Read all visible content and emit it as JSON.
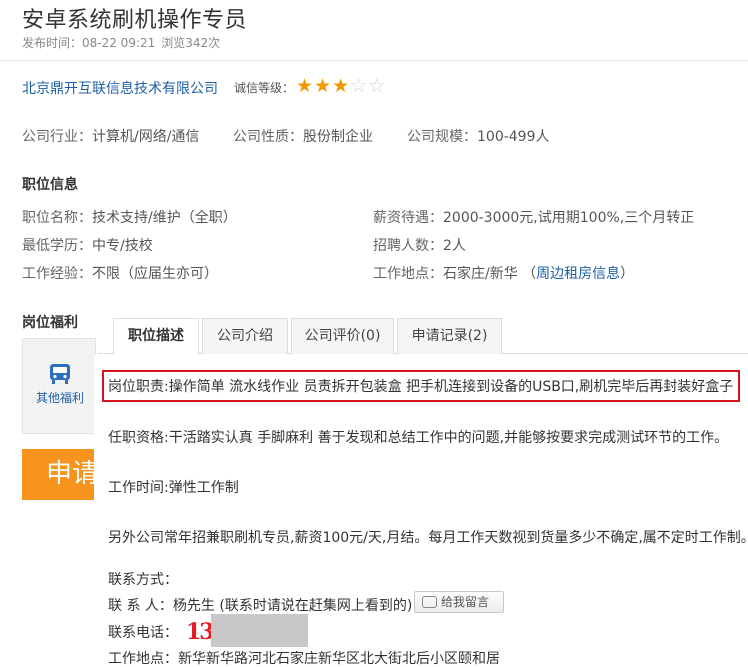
{
  "header": {
    "title": "安卓系统刷机操作专员",
    "publish_time": "发布时间：08-22 09:21",
    "views": "浏览342次"
  },
  "company": {
    "name": "北京鼎开互联信息技术有限公司",
    "credit_label": "诚信等级：",
    "credit_rating": 3,
    "credit_max": 5,
    "industry_label": "公司行业：",
    "industry": "计算机/网络/通信",
    "nature_label": "公司性质：",
    "nature": "股份制企业",
    "size_label": "公司规模：",
    "size": "100-499人"
  },
  "job_info": {
    "section_title": "职位信息",
    "position_label": "职位名称：",
    "position": "技术支持/维护（全职）",
    "salary_label": "薪资待遇：",
    "salary": "2000-3000元,试用期100%,三个月转正",
    "education_label": "最低学历：",
    "education": "中专/技校",
    "headcount_label": "招聘人数：",
    "headcount": "2人",
    "experience_label": "工作经验：",
    "experience": "不限（应届生亦可）",
    "location_label": "工作地点：",
    "location": "石家庄/新华",
    "rent_link": "周边租房信息"
  },
  "benefits": {
    "section_title": "岗位福利",
    "other_label": "其他福利",
    "apply_label": "申请"
  },
  "tabs": [
    {
      "label": "职位描述"
    },
    {
      "label": "公司介绍"
    },
    {
      "label": "公司评价(0)"
    },
    {
      "label": "申请记录(2)"
    }
  ],
  "description": {
    "duty": "岗位职责:操作简单 流水线作业 员责拆开包装盒 把手机连接到设备的USB口,刷机完毕后再封装好盒子",
    "requirement": "任职资格:干活踏实认真 手脚麻利 善于发现和总结工作中的问题,并能够按要求完成测试环节的工作。",
    "work_time": "工作时间:弹性工作制",
    "extra": "另外公司常年招兼职刷机专员,薪资100元/天,月结。每月工作天数视到货量多少不确定,属不定时工作制。"
  },
  "contact": {
    "heading": "联系方式：",
    "person_label": "联 系 人：",
    "person": "杨先生 (联系时请说在赶集网上看到的)",
    "message_button": "给我留言",
    "phone_label": "联系电话：",
    "phone_prefix": "139",
    "address_label": "工作地点：",
    "address": "新华新华路河北石家庄新华区北大街北后小区颐和居"
  },
  "colors": {
    "link": "#1f5fa8",
    "star_on": "#f39800",
    "highlight_border": "#d4131c",
    "apply_button": "#f7941d"
  }
}
